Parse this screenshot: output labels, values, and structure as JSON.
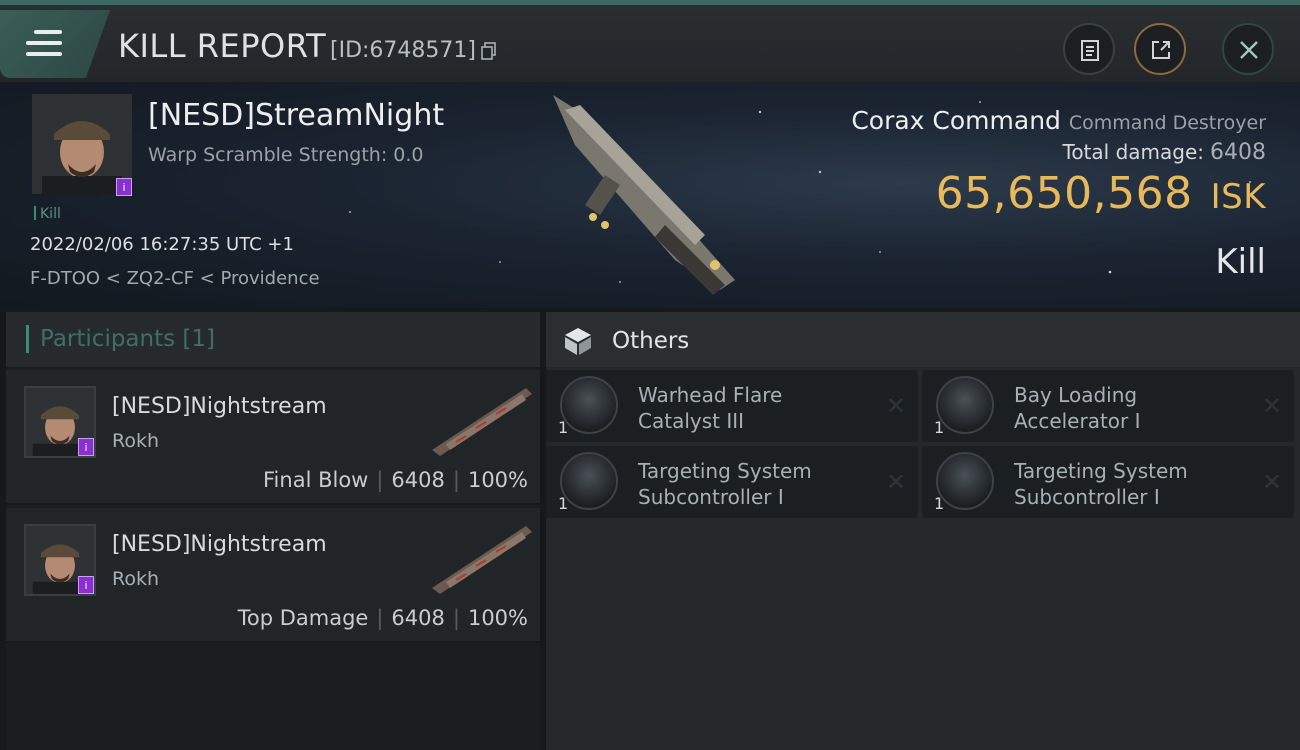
{
  "header": {
    "title": "KILL REPORT",
    "report_id": "[ID:6748571]"
  },
  "victim": {
    "name": "[NESD]StreamNight",
    "warp_scramble": "Warp Scramble Strength: 0.0",
    "tag": "Kill",
    "datetime": "2022/02/06 16:27:35 UTC +1",
    "location": "F-DTOO < ZQ2-CF < Providence",
    "ship_name": "Corax Command",
    "ship_class": "Command Destroyer",
    "total_damage_label": "Total damage:",
    "total_damage": "6408",
    "isk_value": "65,650,568",
    "isk_unit": "ISK",
    "result": "Kill"
  },
  "participants": {
    "label": "Participants [1]",
    "rows": [
      {
        "name": "[NESD]Nightstream",
        "ship": "Rokh",
        "role": "Final Blow",
        "damage": "6408",
        "percent": "100%"
      },
      {
        "name": "[NESD]Nightstream",
        "ship": "Rokh",
        "role": "Top Damage",
        "damage": "6408",
        "percent": "100%"
      }
    ]
  },
  "others": {
    "label": "Others",
    "items": [
      {
        "name_line1": "Warhead Flare",
        "name_line2": "Catalyst III",
        "qty": "1"
      },
      {
        "name_line1": "Bay Loading",
        "name_line2": "Accelerator I",
        "qty": "1"
      },
      {
        "name_line1": "Targeting System",
        "name_line2": "Subcontroller I",
        "qty": "1"
      },
      {
        "name_line1": "Targeting System",
        "name_line2": "Subcontroller I",
        "qty": "1"
      }
    ]
  },
  "icons": {
    "menu": "hamburger-menu-icon",
    "copy": "copy-icon",
    "clipboard": "clipboard-icon",
    "share": "share-icon",
    "close": "close-icon",
    "others": "cube-icon",
    "remove": "x-mark-icon"
  },
  "colors": {
    "accent": "#3f8a7a",
    "isk": "#e8b95a",
    "badge": "#8a2fd1"
  }
}
